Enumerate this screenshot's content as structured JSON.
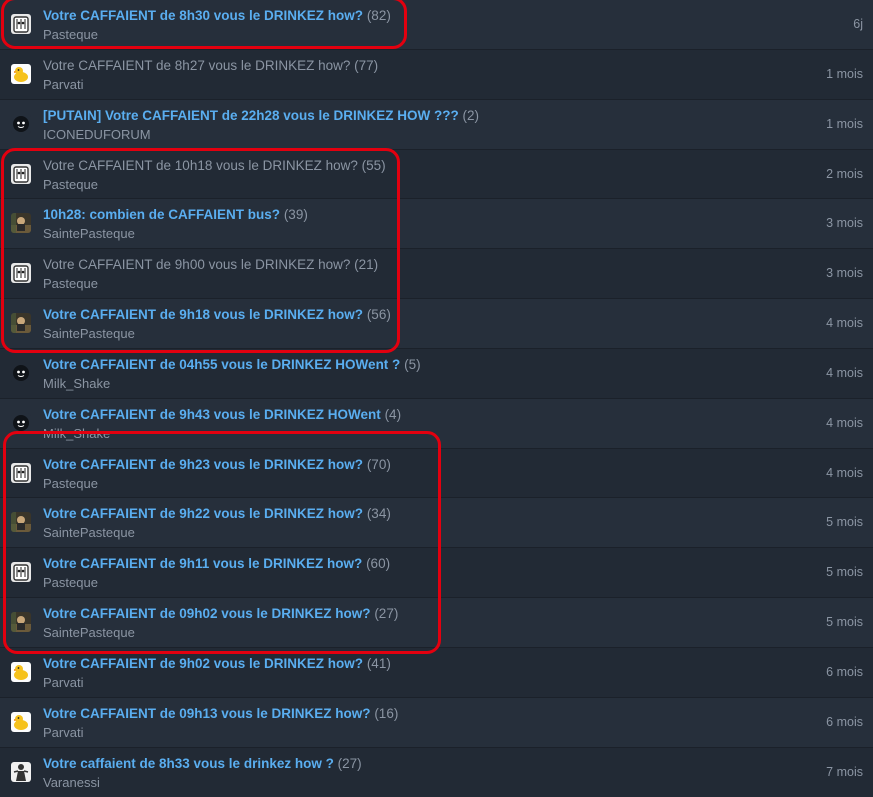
{
  "topics": [
    {
      "title": "Votre CAFFAIENT de 8h30 vous le DRINKEZ how?",
      "count": "(82)",
      "author": "Pasteque",
      "age": "6j",
      "read": false,
      "avatar": "pasteque-avatar"
    },
    {
      "title": "Votre CAFFAIENT de 8h27 vous le DRINKEZ how?",
      "count": "(77)",
      "author": "Parvati",
      "age": "1 mois",
      "read": true,
      "avatar": "duck-avatar"
    },
    {
      "title": "[PUTAIN] Votre CAFFAIENT de 22h28 vous le DRINKEZ HOW ???",
      "count": "(2)",
      "author": "ICONEDUFORUM",
      "age": "1 mois",
      "read": false,
      "avatar": "smiley-avatar"
    },
    {
      "title": "Votre CAFFAIENT de 10h18 vous le DRINKEZ how?",
      "count": "(55)",
      "author": "Pasteque",
      "age": "2 mois",
      "read": true,
      "avatar": "pasteque-avatar"
    },
    {
      "title": "10h28: combien de CAFFAIENT bus?",
      "count": "(39)",
      "author": "SaintePasteque",
      "age": "3 mois",
      "read": false,
      "avatar": "photo-avatar"
    },
    {
      "title": "Votre CAFFAIENT de 9h00 vous le DRINKEZ how?",
      "count": "(21)",
      "author": "Pasteque",
      "age": "3 mois",
      "read": true,
      "avatar": "pasteque-avatar"
    },
    {
      "title": "Votre CAFFAIENT de 9h18 vous le DRINKEZ how?",
      "count": "(56)",
      "author": "SaintePasteque",
      "age": "4 mois",
      "read": false,
      "avatar": "photo-avatar"
    },
    {
      "title": "Votre CAFFAIENT de 04h55 vous le DRINKEZ HOWent ?",
      "count": "(5)",
      "author": "Milk_Shake",
      "age": "4 mois",
      "read": false,
      "avatar": "smiley-avatar"
    },
    {
      "title": "Votre CAFFAIENT de 9h43 vous le DRINKEZ HOWent",
      "count": "(4)",
      "author": "Milk_Shake",
      "age": "4 mois",
      "read": false,
      "avatar": "smiley-avatar"
    },
    {
      "title": "Votre CAFFAIENT de 9h23 vous le DRINKEZ how?",
      "count": "(70)",
      "author": "Pasteque",
      "age": "4 mois",
      "read": false,
      "avatar": "pasteque-avatar"
    },
    {
      "title": "Votre CAFFAIENT de 9h22 vous le DRINKEZ how?",
      "count": "(34)",
      "author": "SaintePasteque",
      "age": "5 mois",
      "read": false,
      "avatar": "photo-avatar"
    },
    {
      "title": "Votre CAFFAIENT de 9h11 vous le DRINKEZ how?",
      "count": "(60)",
      "author": "Pasteque",
      "age": "5 mois",
      "read": false,
      "avatar": "pasteque-avatar"
    },
    {
      "title": "Votre CAFFAIENT de 09h02 vous le DRINKEZ how?",
      "count": "(27)",
      "author": "SaintePasteque",
      "age": "5 mois",
      "read": false,
      "avatar": "photo-avatar"
    },
    {
      "title": "Votre CAFFAIENT de 9h02 vous le DRINKEZ how?",
      "count": "(41)",
      "author": "Parvati",
      "age": "6 mois",
      "read": false,
      "avatar": "duck-avatar"
    },
    {
      "title": "Votre CAFFAIENT de 09h13 vous le DRINKEZ how?",
      "count": "(16)",
      "author": "Parvati",
      "age": "6 mois",
      "read": false,
      "avatar": "duck-avatar"
    },
    {
      "title": "Votre caffaient de 8h33 vous le drinkez how ?",
      "count": "(27)",
      "author": "Varanessi",
      "age": "7 mois",
      "read": false,
      "avatar": "figure-avatar"
    }
  ],
  "colors": {
    "link_unread": "#5aaef0",
    "link_read": "#8b95a3",
    "muted_text": "#8b95a3",
    "row_odd": "#262f3b",
    "row_even": "#222a35",
    "highlight": "#e3000f"
  }
}
